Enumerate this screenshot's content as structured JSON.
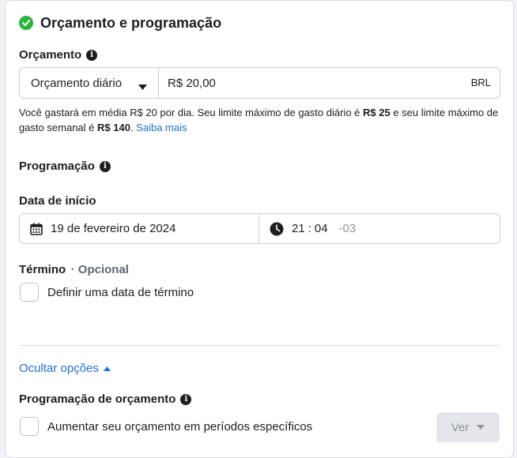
{
  "header": {
    "title": "Orçamento e programação"
  },
  "budget": {
    "label": "Orçamento",
    "type_select": "Orçamento diário",
    "amount_value": "R$ 20,00",
    "currency": "BRL",
    "helper": {
      "part1": "Você gastará em média R$ 20 por dia. Seu limite máximo de gasto diário é ",
      "daily_max": "R$ 25",
      "part2": " e seu limite máximo de gasto semanal é ",
      "weekly_max": "R$ 140",
      "part3": ". ",
      "learn_more": "Saiba mais"
    }
  },
  "schedule": {
    "label": "Programação",
    "start_label": "Data de início",
    "start_date": "19 de fevereiro de 2024",
    "start_hour": "21",
    "time_sep": ":",
    "start_minute": "04",
    "timezone": "-03",
    "end_label": "Término",
    "end_optional": "· Opcional",
    "end_checkbox_label": "Definir uma data de término"
  },
  "options": {
    "toggle_label": "Ocultar opções"
  },
  "budget_schedule": {
    "label": "Programação de orçamento",
    "checkbox_label": "Aumentar seu orçamento em períodos específicos",
    "view_button": "Ver"
  },
  "colors": {
    "accent": "#216fdb",
    "success": "#2bb33a",
    "border": "#ccd0d5"
  }
}
